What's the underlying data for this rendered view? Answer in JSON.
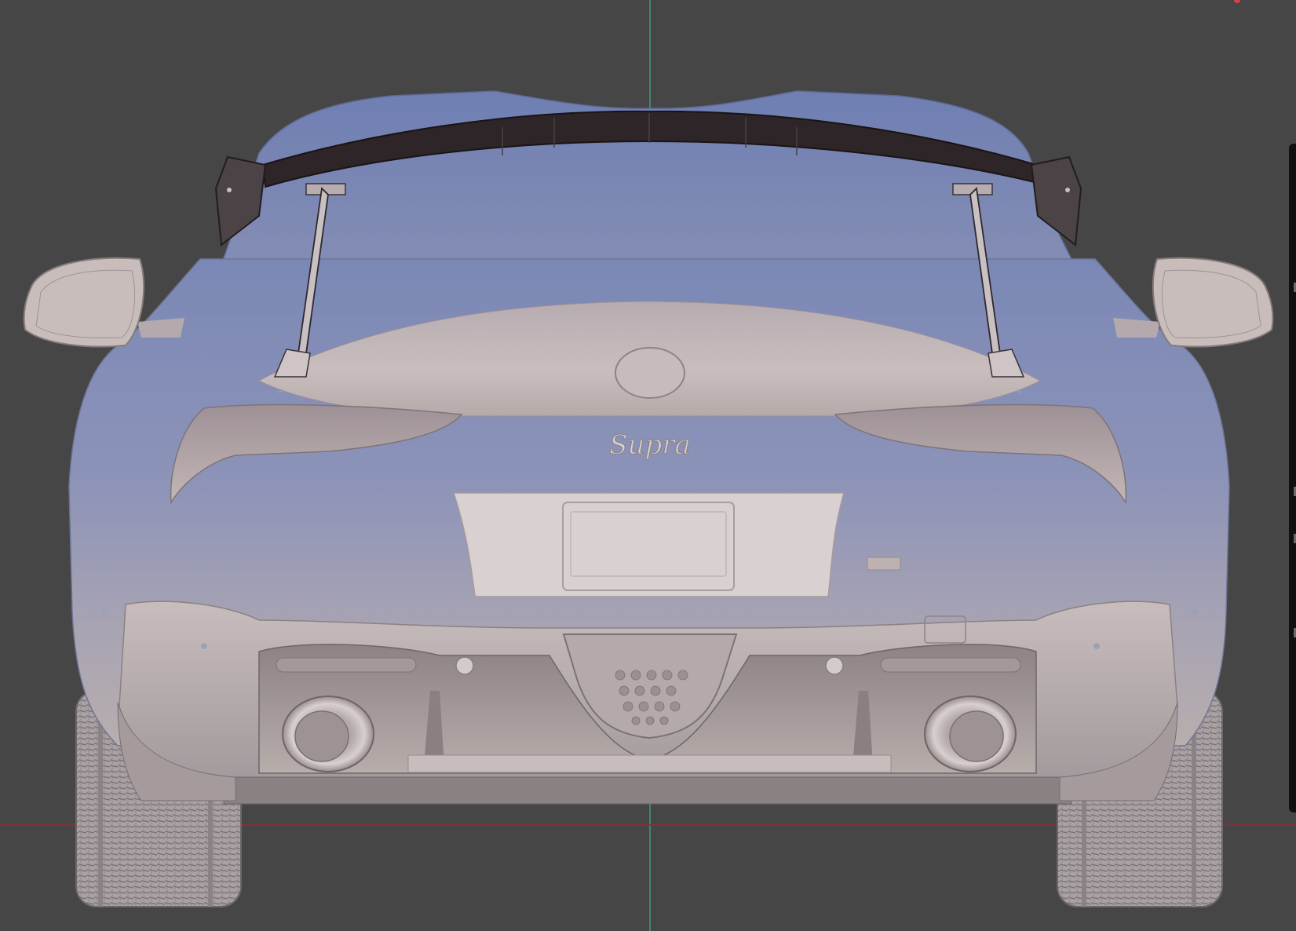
{
  "viewport": {
    "background_color": "#464646",
    "axis_x_color": "#8c2f35",
    "axis_y_color": "#3f8f7a"
  },
  "model": {
    "name": "car-rear-view",
    "badge_text": "Supra",
    "body_color": "#7f8cb8",
    "lower_body_color": "#b3a8aa",
    "wing_color": "#2b2325"
  }
}
